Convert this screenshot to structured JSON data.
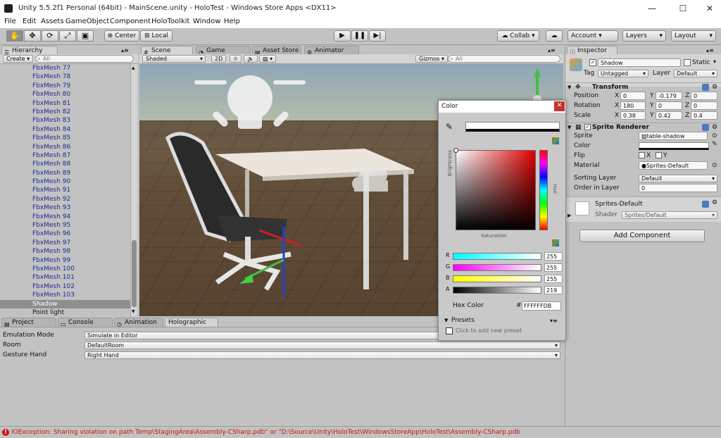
{
  "window": {
    "title": "Unity 5.5.2f1 Personal (64bit) - MainScene.unity - HoloTest - Windows Store Apps <DX11>",
    "minimize": "—",
    "maximize": "☐",
    "close": "✕"
  },
  "menu": [
    "File",
    "Edit",
    "Assets",
    "GameObject",
    "Component",
    "HoloToolkit",
    "Window",
    "Help"
  ],
  "toolbar": {
    "center": "Center",
    "local": "Local",
    "collab": "Collab ▾",
    "account": "Account ▾",
    "layers": "Layers",
    "layout": "Layout"
  },
  "hierarchy": {
    "tab": "Hierarchy",
    "create": "Create ▾",
    "search_placeholder": "All",
    "items": [
      "FbxMesh 77",
      "FbxMesh 78",
      "FbxMesh 79",
      "FbxMesh 80",
      "FbxMesh 81",
      "FbxMesh 82",
      "FbxMesh 83",
      "FbxMesh 84",
      "FbxMesh 85",
      "FbxMesh 86",
      "FbxMesh 87",
      "FbxMesh 88",
      "FbxMesh 89",
      "FbxMesh 90",
      "FbxMesh 91",
      "FbxMesh 92",
      "FbxMesh 93",
      "FbxMesh 94",
      "FbxMesh 95",
      "FbxMesh 96",
      "FbxMesh 97",
      "FbxMesh 98",
      "FbxMesh 99",
      "FbxMesh 100",
      "FbxMesh 101",
      "FbxMesh 102",
      "FbxMesh 103"
    ],
    "selected": "Shadow",
    "last": "Point light"
  },
  "scene": {
    "tabs": [
      "Scene",
      "Game",
      "Asset Store",
      "Animator"
    ],
    "shading": "Shaded",
    "mode2d": "2D",
    "gizmos": "Gizmos ▾",
    "search_placeholder": "All"
  },
  "bottom": {
    "tabs": [
      "Project",
      "Console",
      "Animation",
      "Holographic"
    ],
    "rows": [
      {
        "label": "Emulation Mode",
        "value": "Simulate in Editor"
      },
      {
        "label": "Room",
        "value": "DefaultRoom"
      },
      {
        "label": "Gesture Hand",
        "value": "Right Hand"
      }
    ]
  },
  "status": {
    "message": "IOException: Sharing violation on path Temp\\StagingArea\\Assembly-CSharp.pdb\" or \"D:\\Source\\Unity\\HoloTest\\WindowsStoreApp\\HoloTest\\Assembly-CSharp.pdb"
  },
  "inspector": {
    "tab": "Inspector",
    "name": "Shadow",
    "static": "Static",
    "tag_label": "Tag",
    "tag": "Untagged",
    "layer_label": "Layer",
    "layer": "Default",
    "transform": {
      "title": "Transform",
      "position": {
        "label": "Position",
        "x": "0",
        "y": "-0.179",
        "z": "0"
      },
      "rotation": {
        "label": "Rotation",
        "x": "180",
        "y": "0",
        "z": "0"
      },
      "scale": {
        "label": "Scale",
        "x": "0.38",
        "y": "0.42",
        "z": "0.4"
      }
    },
    "sprite_renderer": {
      "title": "Sprite Renderer",
      "sprite_label": "Sprite",
      "sprite": "table-shadow",
      "color_label": "Color",
      "flip_label": "Flip",
      "flip_x": "X",
      "flip_y": "Y",
      "material_label": "Material",
      "material": "Sprites-Default",
      "sorting_layer_label": "Sorting Layer",
      "sorting_layer": "Default",
      "order_label": "Order in Layer",
      "order": "0"
    },
    "material": {
      "name": "Sprites-Default",
      "shader_label": "Shader",
      "shader": "Sprites/Default"
    },
    "add_component": "Add Component"
  },
  "color_picker": {
    "title": "Color",
    "brightness": "Brightness",
    "saturation": "Saturation",
    "hue": "Hue",
    "channels": [
      {
        "label": "R",
        "value": "255"
      },
      {
        "label": "G",
        "value": "255"
      },
      {
        "label": "B",
        "value": "255"
      },
      {
        "label": "A",
        "value": "219"
      }
    ],
    "hex_label": "Hex Color",
    "hex_value": "FFFFFFDB",
    "presets": "Presets",
    "add_preset": "Click to add new preset"
  },
  "colors": {
    "selection": "#8e8e8e",
    "hierarchy_text": "#1b2c8e",
    "error": "#d01010"
  }
}
